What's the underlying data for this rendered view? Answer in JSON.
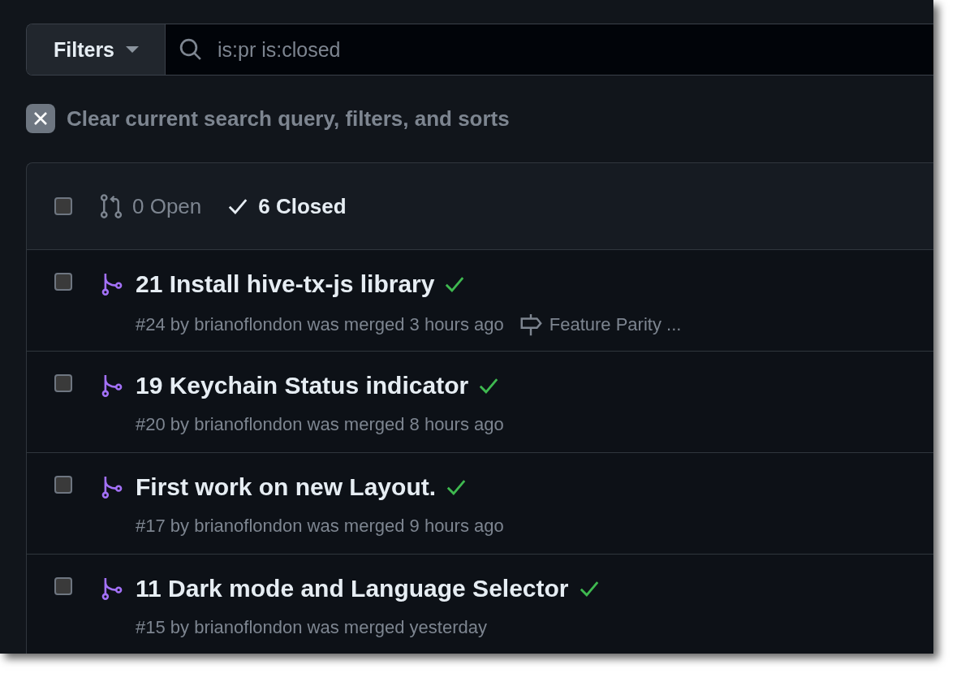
{
  "filters": {
    "label": "Filters"
  },
  "search": {
    "value": "is:pr is:closed"
  },
  "clear": {
    "label": "Clear current search query, filters, and sorts"
  },
  "list_header": {
    "select_all_checked": false,
    "states": [
      {
        "kind": "open",
        "label": "0 Open",
        "selected": false
      },
      {
        "kind": "closed",
        "label": "6 Closed",
        "selected": true
      }
    ]
  },
  "pull_requests": [
    {
      "title": "21 Install hive-tx-js library",
      "checks_passed": true,
      "checked": false,
      "meta": "#24 by brianoflondon was merged 3 hours ago",
      "milestone": "Feature Parity ..."
    },
    {
      "title": "19 Keychain Status indicator",
      "checks_passed": true,
      "checked": false,
      "meta": "#20 by brianoflondon was merged 8 hours ago"
    },
    {
      "title": "First work on new Layout.",
      "checks_passed": true,
      "checked": false,
      "meta": "#17 by brianoflondon was merged 9 hours ago"
    },
    {
      "title": "11 Dark mode and Language Selector",
      "checks_passed": true,
      "checked": false,
      "meta": "#15 by brianoflondon was merged yesterday"
    }
  ]
}
